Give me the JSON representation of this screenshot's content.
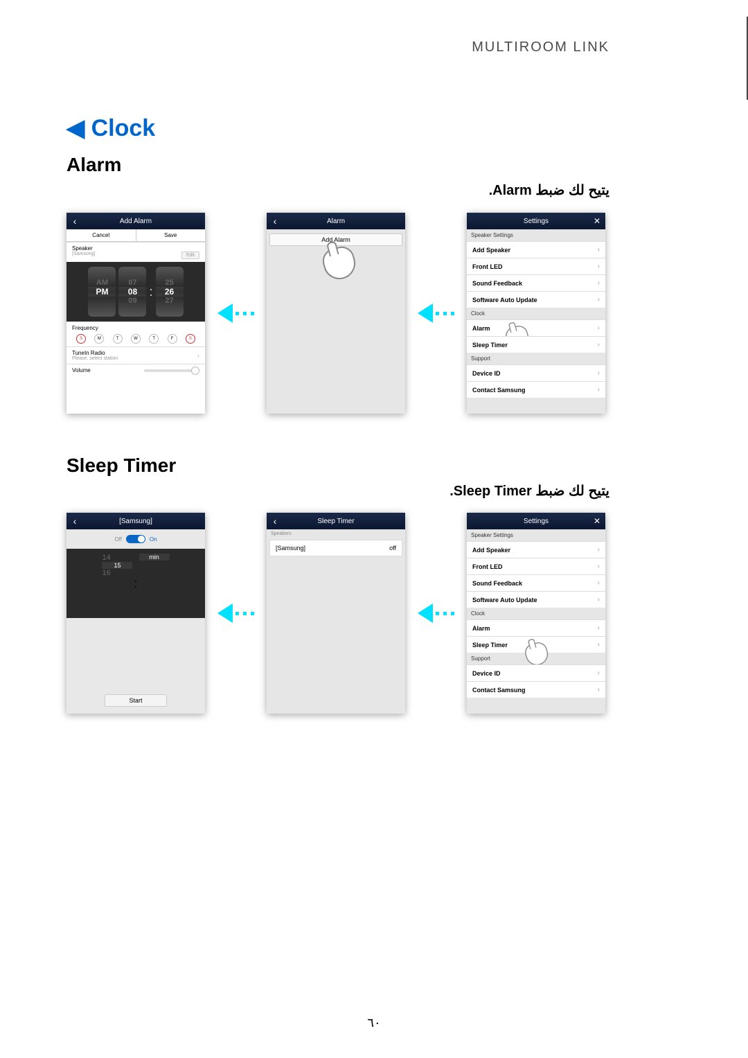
{
  "header": {
    "title": "MULTIROOM LINK"
  },
  "main_title": "◀ Clock",
  "alarm": {
    "title": "Alarm",
    "desc_ar": "يتيح لك ضبط Alarm."
  },
  "sleep": {
    "title": "Sleep Timer",
    "desc_ar": "يتيح لك ضبط Sleep Timer."
  },
  "settings": {
    "title": "Settings",
    "section_speaker": "Speaker Settings",
    "items_speaker": {
      "add_speaker": "Add Speaker",
      "front_led": "Front LED",
      "sound_feedback": "Sound Feedback",
      "software_auto_update": "Software Auto Update"
    },
    "section_clock": "Clock",
    "items_clock": {
      "alarm": "Alarm",
      "sleep_timer": "Sleep Timer"
    },
    "section_support": "Support",
    "items_support": {
      "device_id": "Device ID",
      "contact_samsung": "Contact Samsung"
    }
  },
  "alarm_mid": {
    "title": "Alarm",
    "add_button": "Add Alarm"
  },
  "add_alarm": {
    "title": "Add Alarm",
    "cancel": "Cancel",
    "save": "Save",
    "speaker_label": "Speaker",
    "speaker_value": "[Samsung]",
    "edit": "Edit",
    "ampm_prev": "AM",
    "ampm": "PM",
    "hour_prev": "07",
    "hour": "08",
    "hour_next": "09",
    "min_prev": "25",
    "min": "26",
    "min_next": "27",
    "frequency_label": "Frequency",
    "days": [
      "S",
      "M",
      "T",
      "W",
      "T",
      "F",
      "S"
    ],
    "tunein_label": "TuneIn Radio",
    "tunein_sub": "Please, select station",
    "volume_label": "Volume"
  },
  "sleep_left": {
    "title": "[Samsung]",
    "off": "Off",
    "on": "On",
    "val_prev": "14",
    "val": "15",
    "val_next": "16",
    "unit": "min",
    "start": "Start"
  },
  "sleep_mid": {
    "title": "Sleep Timer",
    "speakers_label": "Speakers",
    "item_name": "[Samsung]",
    "item_state": "off"
  },
  "page_number": "٦٠"
}
